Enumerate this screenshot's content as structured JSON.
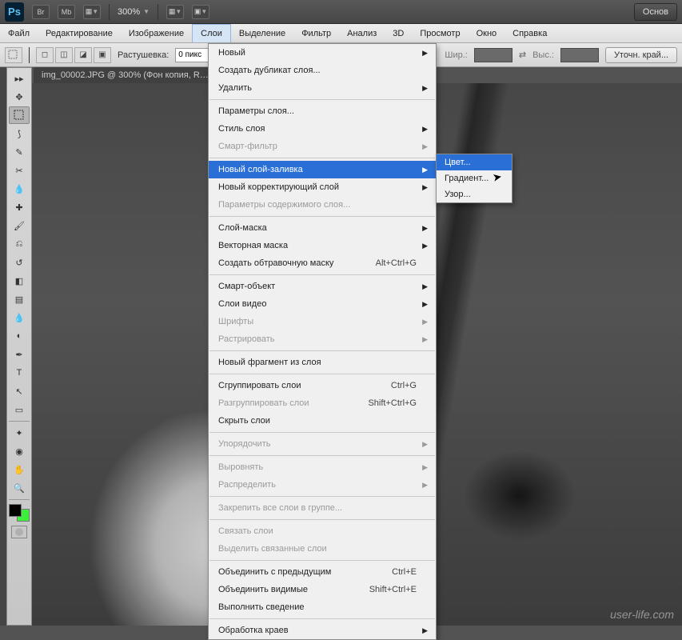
{
  "topbar": {
    "zoom": "300%",
    "right_button": "Основ"
  },
  "menubar": {
    "items": [
      "Файл",
      "Редактирование",
      "Изображение",
      "Слои",
      "Выделение",
      "Фильтр",
      "Анализ",
      "3D",
      "Просмотр",
      "Окно",
      "Справка"
    ],
    "active_index": 3
  },
  "optionsbar": {
    "feather_label": "Растушевка:",
    "feather_value": "0 пикс",
    "width_label": "Шир.:",
    "height_label": "Выс.:",
    "refine_button": "Уточн. край..."
  },
  "tab": {
    "title": "img_00002.JPG @ 300% (Фон копия, R…"
  },
  "layer_menu": [
    {
      "label": "Новый",
      "arrow": true
    },
    {
      "label": "Создать дубликат слоя..."
    },
    {
      "label": "Удалить",
      "arrow": true
    },
    {
      "sep": true
    },
    {
      "label": "Параметры слоя..."
    },
    {
      "label": "Стиль слоя",
      "arrow": true
    },
    {
      "label": "Смарт-фильтр",
      "arrow": true,
      "disabled": true
    },
    {
      "sep": true
    },
    {
      "label": "Новый слой-заливка",
      "arrow": true,
      "highlight": true
    },
    {
      "label": "Новый корректирующий слой",
      "arrow": true
    },
    {
      "label": "Параметры содержимого слоя...",
      "disabled": true
    },
    {
      "sep": true
    },
    {
      "label": "Слой-маска",
      "arrow": true
    },
    {
      "label": "Векторная маска",
      "arrow": true
    },
    {
      "label": "Создать обтравочную маску",
      "shortcut": "Alt+Ctrl+G"
    },
    {
      "sep": true
    },
    {
      "label": "Смарт-объект",
      "arrow": true
    },
    {
      "label": "Слои видео",
      "arrow": true
    },
    {
      "label": "Шрифты",
      "arrow": true,
      "disabled": true
    },
    {
      "label": "Растрировать",
      "arrow": true,
      "disabled": true
    },
    {
      "sep": true
    },
    {
      "label": "Новый фрагмент из слоя"
    },
    {
      "sep": true
    },
    {
      "label": "Сгруппировать слои",
      "shortcut": "Ctrl+G"
    },
    {
      "label": "Разгруппировать слои",
      "shortcut": "Shift+Ctrl+G",
      "disabled": true
    },
    {
      "label": "Скрыть слои"
    },
    {
      "sep": true
    },
    {
      "label": "Упорядочить",
      "arrow": true,
      "disabled": true
    },
    {
      "sep": true
    },
    {
      "label": "Выровнять",
      "arrow": true,
      "disabled": true
    },
    {
      "label": "Распределить",
      "arrow": true,
      "disabled": true
    },
    {
      "sep": true
    },
    {
      "label": "Закрепить все слои в группе...",
      "disabled": true
    },
    {
      "sep": true
    },
    {
      "label": "Связать слои",
      "disabled": true
    },
    {
      "label": "Выделить связанные слои",
      "disabled": true
    },
    {
      "sep": true
    },
    {
      "label": "Объединить с предыдущим",
      "shortcut": "Ctrl+E"
    },
    {
      "label": "Объединить видимые",
      "shortcut": "Shift+Ctrl+E"
    },
    {
      "label": "Выполнить сведение"
    },
    {
      "sep": true
    },
    {
      "label": "Обработка краев",
      "arrow": true
    }
  ],
  "submenu": [
    {
      "label": "Цвет...",
      "highlight": true
    },
    {
      "label": "Градиент..."
    },
    {
      "label": "Узор..."
    }
  ],
  "watermark": "user-life.com"
}
